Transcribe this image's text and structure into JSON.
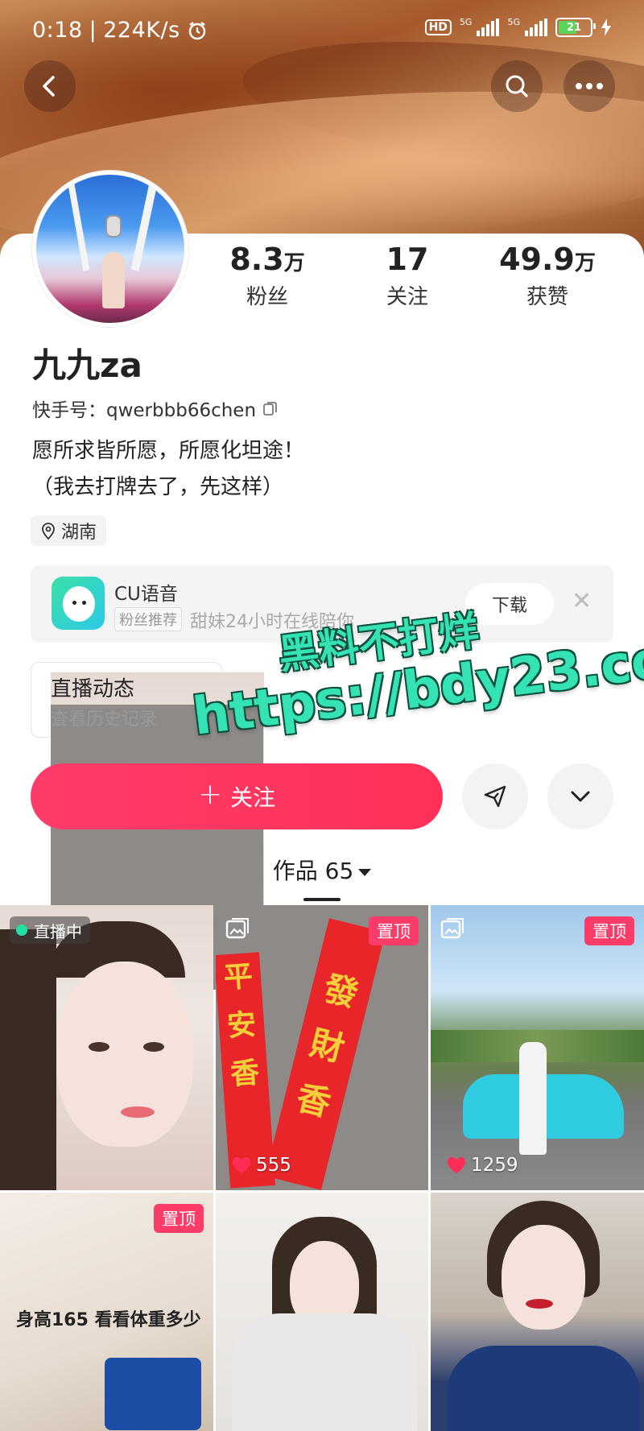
{
  "status_bar": {
    "time": "0:18",
    "net_speed": "224K/s",
    "hd_badge": "HD",
    "net_type_1": "5G",
    "net_type_2": "5G",
    "battery": "21"
  },
  "header": {
    "back_icon": "back-arrow-icon",
    "search_icon": "search-icon",
    "more_icon": "more-dots-icon"
  },
  "stats": [
    {
      "value": "8.3",
      "unit": "万",
      "label": "粉丝"
    },
    {
      "value": "17",
      "unit": "",
      "label": "关注"
    },
    {
      "value": "49.9",
      "unit": "万",
      "label": "获赞"
    }
  ],
  "profile": {
    "name": "九九za",
    "kuaishou_id": "快手号：qwerbbb66chen",
    "bio_line1": "愿所求皆所愿，所愿化坦途！",
    "bio_line2": "（我去打牌去了，先这样）",
    "location": "湖南"
  },
  "ad": {
    "title": "CU语音",
    "tag": "粉丝推荐",
    "description": "甜妹24小时在线陪你",
    "download": "下载"
  },
  "live_history": {
    "title": "直播动态",
    "subtitle": "查看历史记录"
  },
  "actions": {
    "follow": "关注"
  },
  "works": {
    "label": "作品",
    "count": "65"
  },
  "tiles": [
    {
      "badge": "直播中"
    },
    {
      "pin": "置顶",
      "likes": "555",
      "text_left": "平安香",
      "text_right": "發財香"
    },
    {
      "pin": "置顶",
      "likes": "1259"
    },
    {
      "pin": "置顶",
      "caption": "身高165 看看体重多少"
    },
    {},
    {}
  ],
  "watermark": {
    "line1": "黑料不打烊",
    "line2": "https://bdy23.co"
  },
  "colors": {
    "accent": "#fe3c6a",
    "live_dot": "#1fe0a0",
    "watermark": "#35e2b3"
  }
}
